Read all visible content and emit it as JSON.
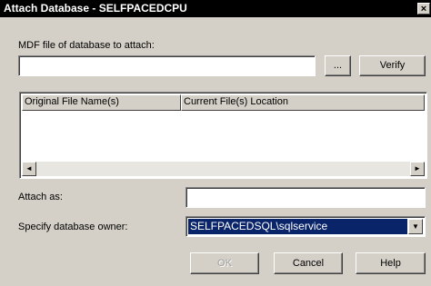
{
  "window": {
    "title": "Attach Database - SELFPACEDCPU",
    "close_glyph": "×"
  },
  "mdf": {
    "label": "MDF file of database to attach:",
    "value": "",
    "browse_label": "...",
    "verify_label": "Verify"
  },
  "files_list": {
    "columns": [
      "Original File Name(s)",
      "Current File(s) Location"
    ],
    "rows": [],
    "scroll_left_glyph": "◄",
    "scroll_right_glyph": "►"
  },
  "attach_as": {
    "label": "Attach as:",
    "value": ""
  },
  "owner": {
    "label": "Specify database owner:",
    "selected": "SELFPACEDSQL\\sqlservice",
    "dropdown_glyph": "▼"
  },
  "buttons": {
    "ok": "OK",
    "cancel": "Cancel",
    "help": "Help"
  },
  "icons": {
    "close": "close-icon",
    "dropdown": "chevron-down-icon",
    "scroll_left": "arrow-left-icon",
    "scroll_right": "arrow-right-icon"
  }
}
